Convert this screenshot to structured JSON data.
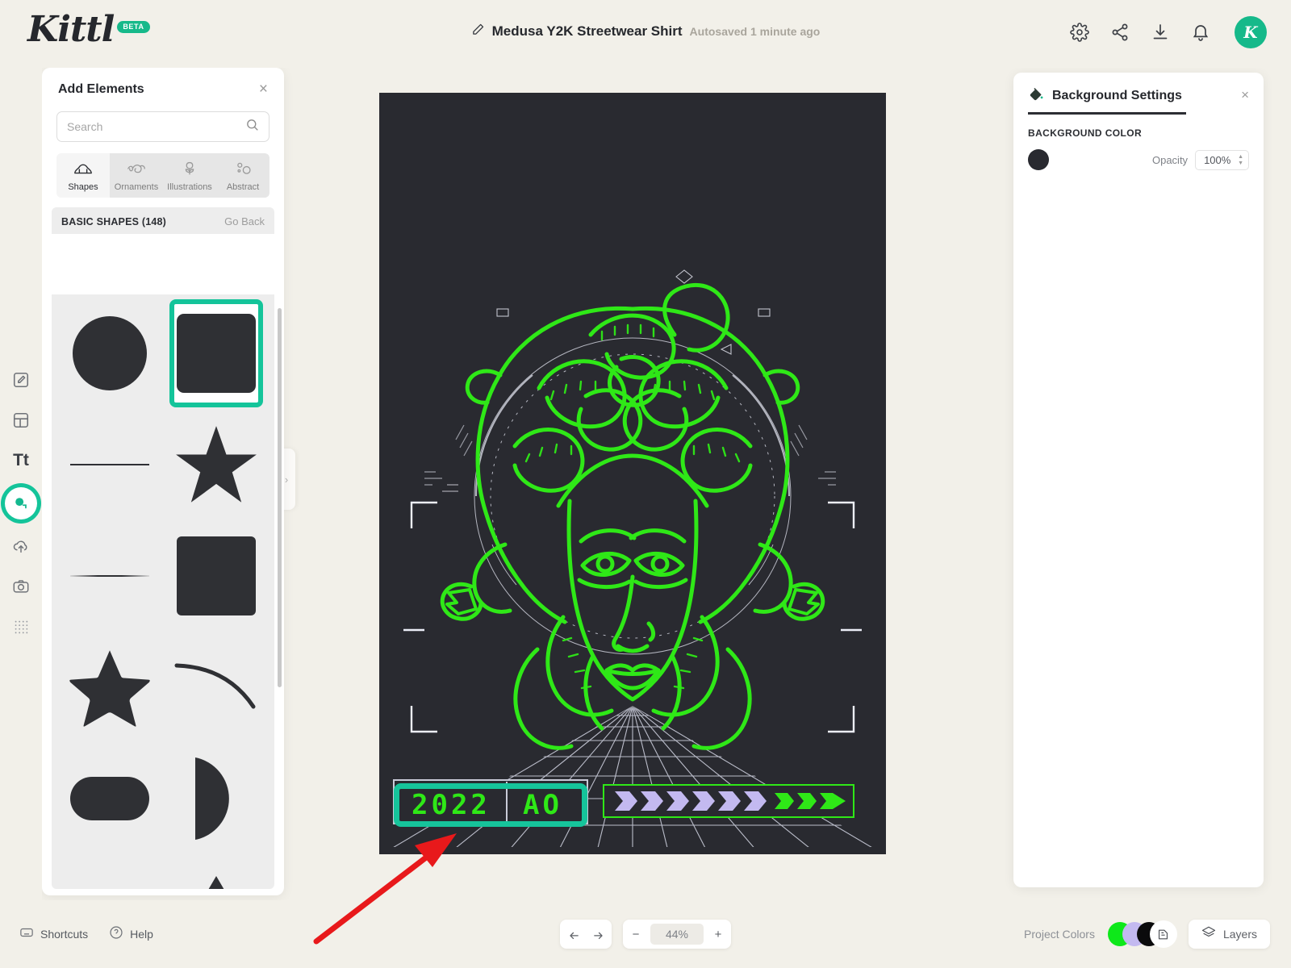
{
  "app": {
    "brand": "Kittl",
    "brand_badge": "BETA",
    "background_color": "#f2f0e9",
    "accent_color": "#14c49a"
  },
  "header": {
    "doc_title": "Medusa Y2K Streetwear Shirt",
    "saved_status": "Autosaved 1 minute ago",
    "edit_icon": "pencil-icon",
    "actions": [
      {
        "name": "settings-icon",
        "label": "Settings"
      },
      {
        "name": "share-icon",
        "label": "Share"
      },
      {
        "name": "download-icon",
        "label": "Download"
      },
      {
        "name": "notifications-icon",
        "label": "Notifications"
      }
    ],
    "avatar_initial": "K"
  },
  "rail": {
    "items": [
      {
        "name": "design-icon",
        "label": "Design",
        "active": false
      },
      {
        "name": "templates-icon",
        "label": "Templates",
        "active": false
      },
      {
        "name": "text-icon",
        "label": "Tt",
        "active": false
      },
      {
        "name": "elements-icon",
        "label": "Elements",
        "active": true
      },
      {
        "name": "uploads-icon",
        "label": "Uploads",
        "active": false
      },
      {
        "name": "photos-icon",
        "label": "Photos",
        "active": false
      },
      {
        "name": "patterns-icon",
        "label": "Patterns",
        "active": false
      }
    ]
  },
  "left_panel": {
    "title": "Add Elements",
    "close_label": "×",
    "search": {
      "value": "",
      "placeholder": "Search",
      "icon": "search-icon"
    },
    "tabs": [
      {
        "label": "Shapes",
        "icon": "shapes-icon",
        "active": true
      },
      {
        "label": "Ornaments",
        "icon": "ornaments-icon",
        "active": false
      },
      {
        "label": "Illustrations",
        "icon": "illustrations-icon",
        "active": false
      },
      {
        "label": "Abstract",
        "icon": "abstract-icon",
        "active": false
      }
    ],
    "section": {
      "title": "BASIC SHAPES (148)",
      "back_label": "Go Back"
    },
    "shapes": [
      {
        "name": "shape-circle",
        "kind": "circle",
        "selected": false
      },
      {
        "name": "shape-square",
        "kind": "square",
        "selected": true
      },
      {
        "name": "shape-line",
        "kind": "line",
        "selected": false
      },
      {
        "name": "shape-star-5",
        "kind": "star-sharp",
        "selected": false
      },
      {
        "name": "shape-line-fade",
        "kind": "line-fade",
        "selected": false
      },
      {
        "name": "shape-square-2",
        "kind": "square2",
        "selected": false
      },
      {
        "name": "shape-star-rounded",
        "kind": "star-round",
        "selected": false
      },
      {
        "name": "shape-arc",
        "kind": "arc",
        "selected": false
      },
      {
        "name": "shape-pill",
        "kind": "pill",
        "selected": false
      },
      {
        "name": "shape-half-circle",
        "kind": "half-circle",
        "selected": false
      },
      {
        "name": "shape-line-2",
        "kind": "line",
        "selected": false
      },
      {
        "name": "shape-triangle",
        "kind": "triangle",
        "selected": false
      }
    ],
    "collapse_icon": "chevron-right-icon"
  },
  "right_panel": {
    "title": "Background Settings",
    "icon": "paint-bucket-icon",
    "close_label": "×",
    "background_color_label": "BACKGROUND COLOR",
    "swatch_color": "#292a30",
    "opacity_label": "Opacity",
    "opacity_value": "100%"
  },
  "canvas": {
    "artboard_color": "#292a30",
    "art_line_color": "#2fe817",
    "hud_color": "#e9e9f2",
    "badge": {
      "year": "2022",
      "divider": "|",
      "code": "AO",
      "selected": true
    },
    "selection_color": "#16c49b"
  },
  "annotation": {
    "arrow_color": "#e8191b",
    "points_to": "badge-2022-ao"
  },
  "bottom_bar": {
    "shortcuts_label": "Shortcuts",
    "shortcuts_icon": "keyboard-icon",
    "help_label": "Help",
    "help_icon": "question-circle-icon",
    "undo_icon": "undo-icon",
    "redo_icon": "redo-icon",
    "zoom_out": "−",
    "zoom_value": "44%",
    "zoom_in": "+",
    "project_colors_label": "Project Colors",
    "project_colors": [
      "#0ee81a",
      "#c3b9f0",
      "#0b0b0c"
    ],
    "palette_icon": "palette-icon",
    "layers_label": "Layers",
    "layers_icon": "layers-icon"
  }
}
